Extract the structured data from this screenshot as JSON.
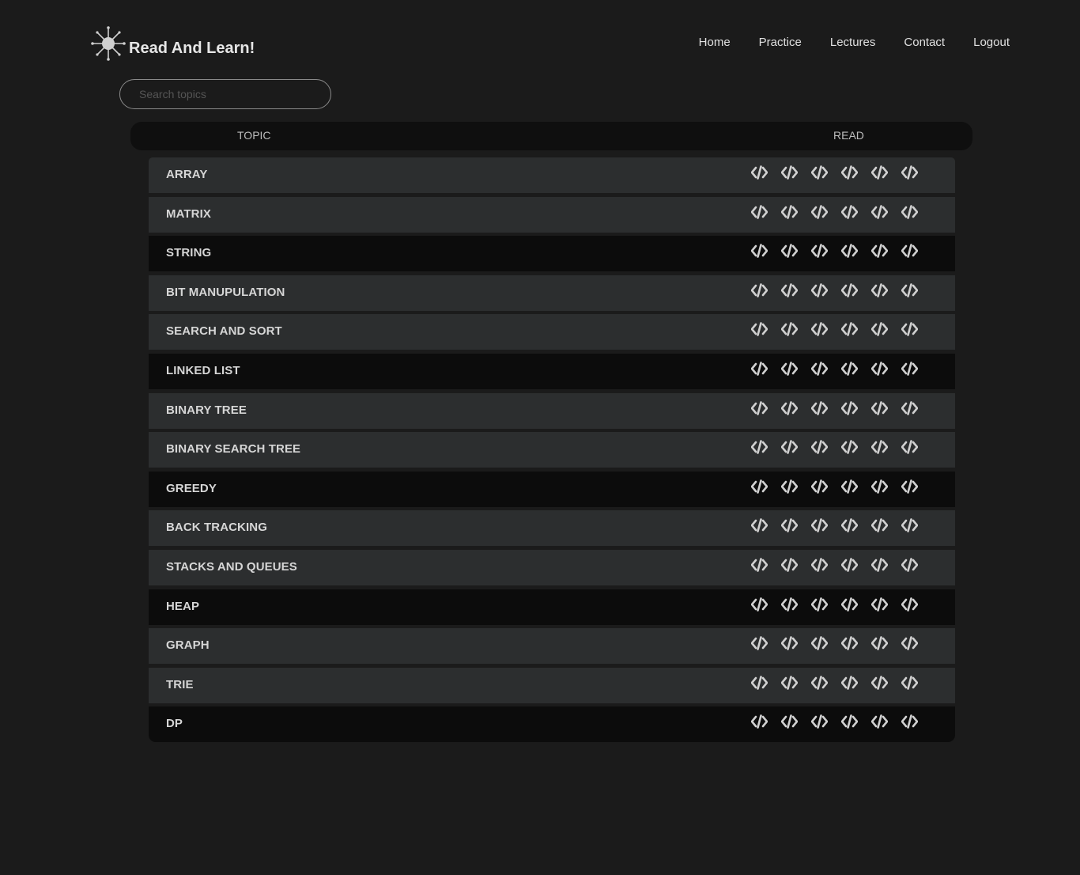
{
  "header": {
    "brand": "Read And Learn!",
    "logo_icon": "virus-icon",
    "nav": [
      "Home",
      "Practice",
      "Lectures",
      "Contact",
      "Logout"
    ]
  },
  "search": {
    "placeholder": "Search topics",
    "value": ""
  },
  "table": {
    "columns": [
      "TOPIC",
      "READ"
    ],
    "read_icon": "code-icon",
    "read_links_per_row": 6,
    "rows": [
      {
        "label": "ARRAY",
        "style": "light"
      },
      {
        "label": "MATRIX",
        "style": "light"
      },
      {
        "label": "STRING",
        "style": "dark"
      },
      {
        "label": "BIT MANUPULATION",
        "style": "light"
      },
      {
        "label": "SEARCH AND SORT",
        "style": "light"
      },
      {
        "label": "LINKED LIST",
        "style": "dark"
      },
      {
        "label": "BINARY TREE",
        "style": "light"
      },
      {
        "label": "BINARY SEARCH TREE",
        "style": "light"
      },
      {
        "label": "GREEDY",
        "style": "dark"
      },
      {
        "label": "BACK TRACKING",
        "style": "light"
      },
      {
        "label": "STACKS AND QUEUES",
        "style": "light"
      },
      {
        "label": "HEAP",
        "style": "dark"
      },
      {
        "label": "GRAPH",
        "style": "light"
      },
      {
        "label": "TRIE",
        "style": "light"
      },
      {
        "label": "DP",
        "style": "dark"
      }
    ]
  },
  "colors": {
    "background": "#1b1b1b",
    "row_light": "#2c2e2f",
    "row_dark": "#0c0c0c",
    "header_bar": "#0f0f0f",
    "text": "#d6d6d6"
  }
}
